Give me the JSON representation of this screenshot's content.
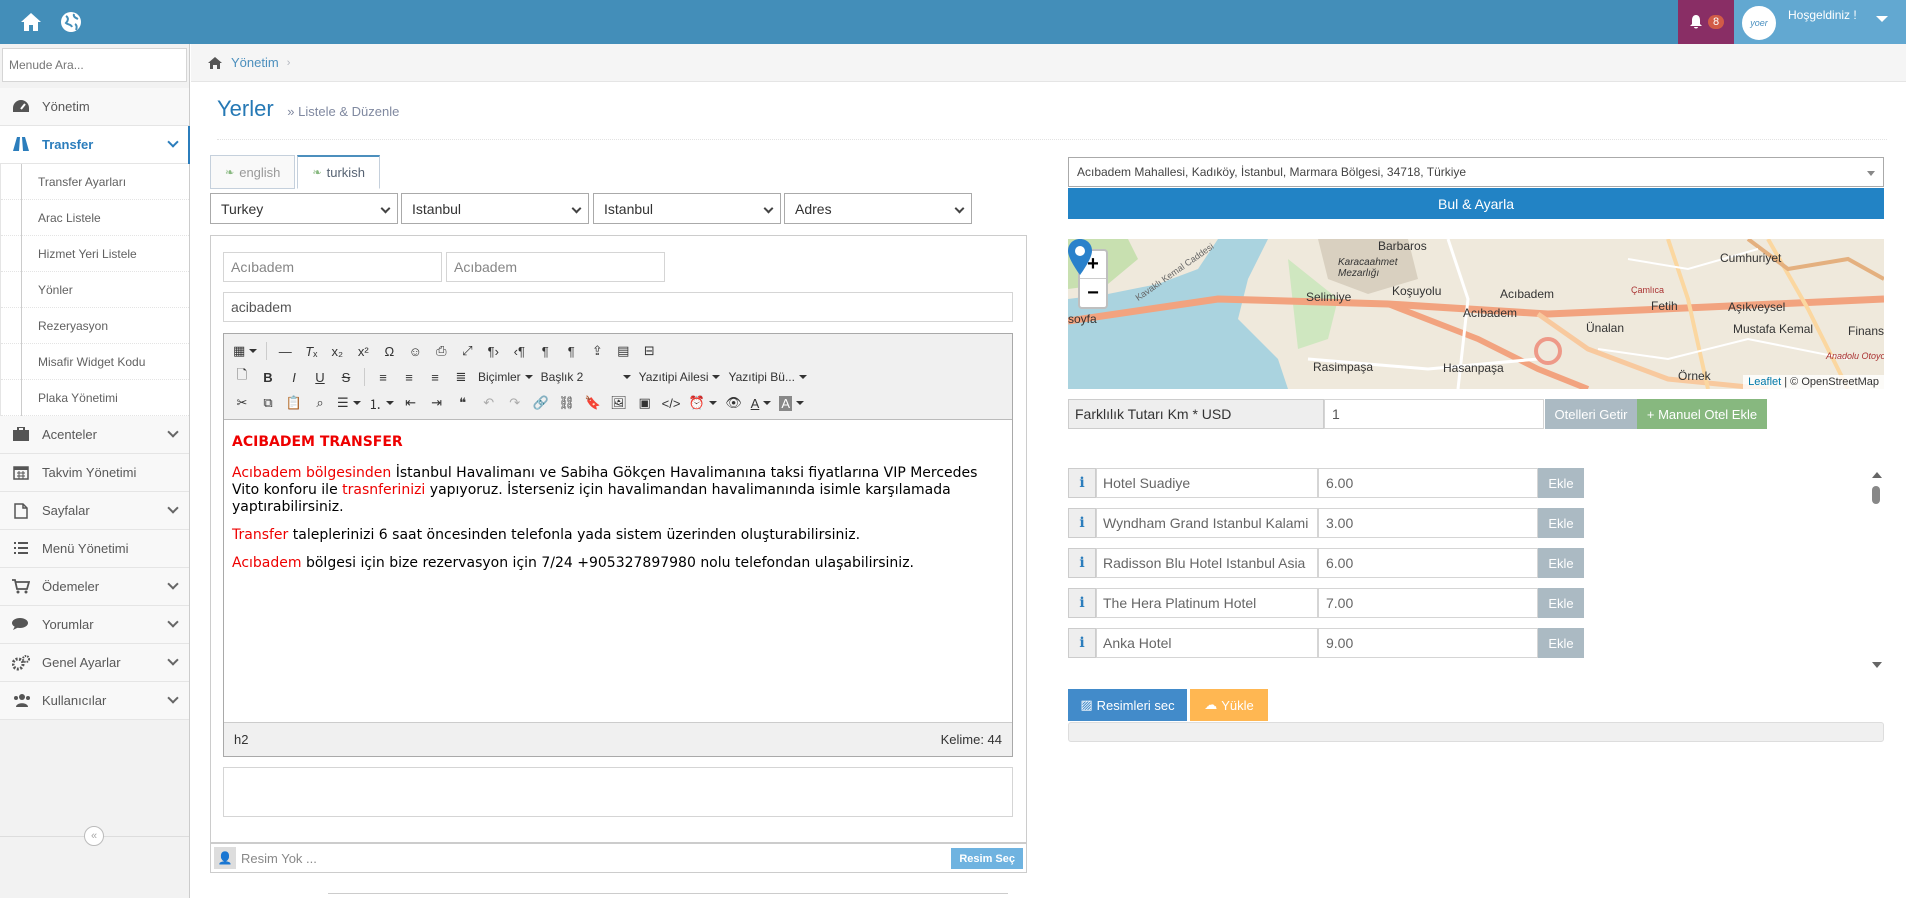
{
  "topbar": {
    "greeting": "Hoşgeldiniz !",
    "notification_count": "8",
    "avatar_text": "yoer"
  },
  "sidebar": {
    "search_placeholder": "Menude Ara...",
    "items": [
      {
        "label": "Yönetim",
        "icon": "dashboard-icon"
      },
      {
        "label": "Transfer",
        "icon": "road-icon",
        "active": true
      },
      {
        "label": "Acenteler",
        "icon": "briefcase-icon"
      },
      {
        "label": "Takvim Yönetimi",
        "icon": "calendar-icon"
      },
      {
        "label": "Sayfalar",
        "icon": "file-icon"
      },
      {
        "label": "Menü Yönetimi",
        "icon": "list-icon"
      },
      {
        "label": "Ödemeler",
        "icon": "cart-icon"
      },
      {
        "label": "Yorumlar",
        "icon": "comments-icon"
      },
      {
        "label": "Genel Ayarlar",
        "icon": "cogs-icon"
      },
      {
        "label": "Kullanıcılar",
        "icon": "users-icon"
      }
    ],
    "sub_items": [
      "Transfer Ayarları",
      "Arac Listele",
      "Hizmet Yeri Listele",
      "Yönler",
      "Rezeryasyon",
      "Misafir Widget Kodu",
      "Plaka Yönetimi"
    ]
  },
  "breadcrumb": {
    "home": "Yönetim"
  },
  "page": {
    "title": "Yerler",
    "subtitle": "» Listele & Düzenle"
  },
  "tabs": [
    {
      "label": "english"
    },
    {
      "label": "turkish",
      "active": true
    }
  ],
  "selects": {
    "country": "Turkey",
    "city": "Istanbul",
    "district": "Istanbul",
    "type": "Adres"
  },
  "form": {
    "name_placeholder_1": "Acıbadem",
    "name_placeholder_2": "Acıbadem",
    "slug": "acibadem"
  },
  "editor": {
    "toolbar": {
      "format_label": "Biçimler",
      "heading_label": "Başlık 2",
      "font_family_label": "Yazıtipi Ailesi",
      "font_size_label": "Yazıtipi Bü..."
    },
    "heading": "ACIBADEM TRANSFER",
    "p1_red1": "Acıbadem bölgesinden",
    "p1_text1": " İstanbul Havalimanı ve Sabiha Gökçen Havalimanına taksi fiyatlarına VIP Mercedes Vito konforu ile ",
    "p1_red2": "trasnferinizi",
    "p1_text2": " yapıyoruz. İsterseniz  için havalimandan havalimanında isimle karşılamada yaptırabilirsiniz.",
    "p2_red": "Transfer",
    "p2_text": " taleplerinizi 6 saat öncesinden telefonla yada sistem üzerinden oluşturabilirsiniz.",
    "p3_red": "Acıbadem",
    "p3_text": " bölgesi için bize rezervasyon için 7/24 +905327897980 nolu telefondan ulaşabilirsiniz.",
    "status_path": "h2",
    "word_count": "Kelime: 44"
  },
  "image_row": {
    "text": "Resim Yok ...",
    "button": "Resim Seç"
  },
  "right": {
    "address": "Acıbadem Mahallesi, Kadıköy, İstanbul, Marmara Bölgesi, 34718, Türkiye",
    "find_button": "Bul & Ayarla",
    "map": {
      "labels": [
        "Barbaros",
        "Karacaahmet Mezarlığı",
        "Cumhuriyet",
        "Selimiye",
        "Koşuyolu",
        "Acıbadem",
        "Çamlıca",
        "Fetih",
        "Aşıkveysel",
        "Ünalan",
        "Mustafa Kemal",
        "Finans",
        "Rasimpaşa",
        "Hasanpaşa",
        "Örnek",
        "Anadolu Otoyolu",
        "Kavaklı Kemal Caddesi",
        "Acıbadem",
        "soyfa"
      ],
      "zoom_in": "+",
      "zoom_out": "−",
      "attribution_link": "Leaflet",
      "attribution_text": " | © OpenStreetMap"
    },
    "diff_label": "Farklılık Tutarı Km * USD",
    "diff_value": "1",
    "hotels_button": "Otelleri Getir",
    "manual_button": "+ Manuel Otel Ekle",
    "hotels": [
      {
        "name": "Hotel Suadiye",
        "value": "6.00",
        "button": "Ekle"
      },
      {
        "name": "Wyndham Grand Istanbul Kalami",
        "value": "3.00",
        "button": "Ekle"
      },
      {
        "name": "Radisson Blu Hotel Istanbul Asia",
        "value": "6.00",
        "button": "Ekle"
      },
      {
        "name": "The Hera Platinum Hotel",
        "value": "7.00",
        "button": "Ekle"
      },
      {
        "name": "Anka Hotel",
        "value": "9.00",
        "button": "Ekle"
      }
    ],
    "select_images_button": "Resimleri sec",
    "upload_button": "Yükle"
  },
  "colors": {
    "topbar": "#438eb9",
    "accent": "#2283c5",
    "red_text": "#e00000"
  }
}
